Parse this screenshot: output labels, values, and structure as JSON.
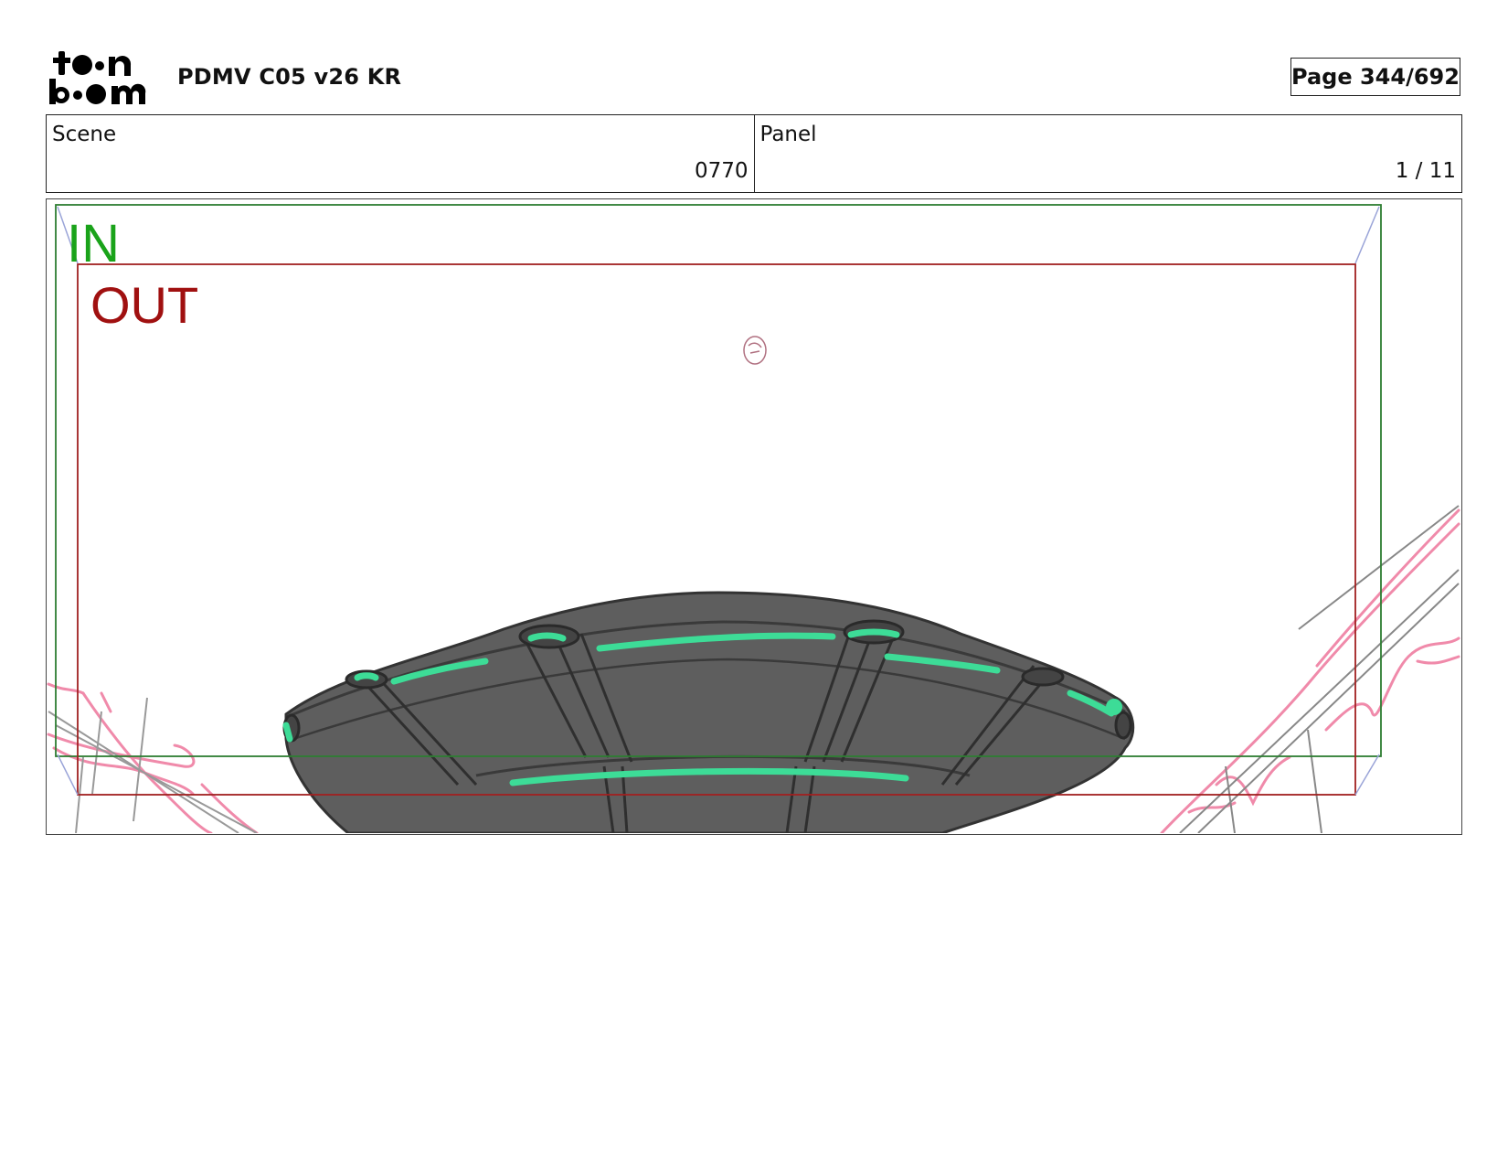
{
  "header": {
    "logo_name": "toon-boom-logo",
    "doc_title": "PDMV C05 v26 KR",
    "page_label": "Page 344/692"
  },
  "info": {
    "scene_label": "Scene",
    "scene_value": "0770",
    "panel_label": "Panel",
    "panel_value": "1 / 11"
  },
  "panel": {
    "in_label": "IN",
    "out_label": "OUT",
    "colors": {
      "in_frame": "#2e7d32",
      "out_frame": "#a02020",
      "ship_body": "#5e5e5e",
      "ship_lights": "#3ddc97",
      "sketch_pink": "#f08aaa"
    }
  }
}
